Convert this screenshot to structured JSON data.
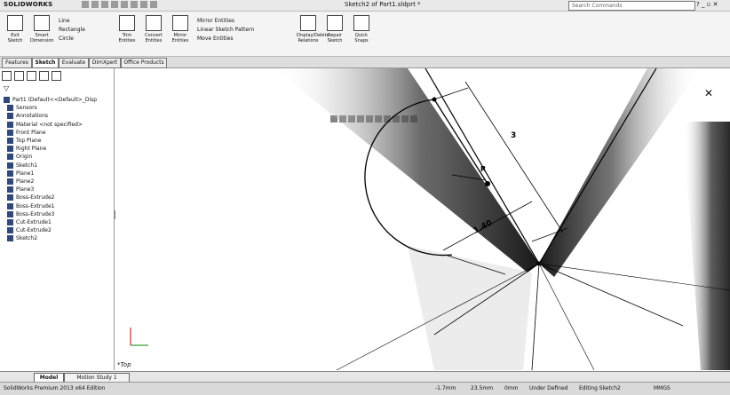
{
  "app": {
    "brand": "SOLIDWORKS",
    "title": "Sketch2 of Part1.sldprt *",
    "search_placeholder": "Search Commands",
    "window_controls": "? _ ▫ ✕"
  },
  "ribbon": {
    "buttons": [
      {
        "name": "sketch",
        "label": "Exit Sketch"
      },
      {
        "name": "smart-dimension",
        "label": "Smart Dimension"
      },
      {
        "name": "trim",
        "label": "Trim Entities"
      },
      {
        "name": "convert",
        "label": "Convert Entities"
      },
      {
        "name": "mirror",
        "label": "Mirror Entities"
      },
      {
        "name": "display-relations",
        "label": "Display/Delete Relations"
      },
      {
        "name": "repair",
        "label": "Repair Sketch"
      },
      {
        "name": "quick-snaps",
        "label": "Quick Snaps"
      }
    ],
    "tools_col1": [
      "Line",
      "Rectangle",
      "Circle"
    ],
    "tools_col2": [
      "Mirror Entities",
      "Linear Sketch Pattern",
      "Move Entities"
    ]
  },
  "tabs": [
    "Features",
    "Sketch",
    "Evaluate",
    "DimXpert",
    "Office Products"
  ],
  "panel": {
    "filter_icon": "funnel-icon",
    "root": "Part1 (Default<<Default>_Disp",
    "items": [
      "Sensors",
      "Annotations",
      "Material <not specified>",
      "Front Plane",
      "Top Plane",
      "Right Plane",
      "Origin",
      "Sketch1",
      "Plane1",
      "Plane2",
      "Plane3",
      "Boss-Extrude2",
      "Boss-Extrude1",
      "Boss-Extrude3",
      "Cut-Extrude1",
      "Cut-Extrude2",
      "Sketch2"
    ]
  },
  "canvas": {
    "view_label": "*Top",
    "dim_a": "3",
    "dim_b": "1.40",
    "dim_c": "R"
  },
  "bottom_tabs": [
    "Model",
    "Motion Study 1"
  ],
  "status": {
    "edition": "SolidWorks Premium 2013 x64 Edition",
    "x": "-1.7mm",
    "y": "23.5mm",
    "z": "0mm",
    "defined": "Under Defined",
    "editing": "Editing Sketch2",
    "units": "MMGS"
  }
}
